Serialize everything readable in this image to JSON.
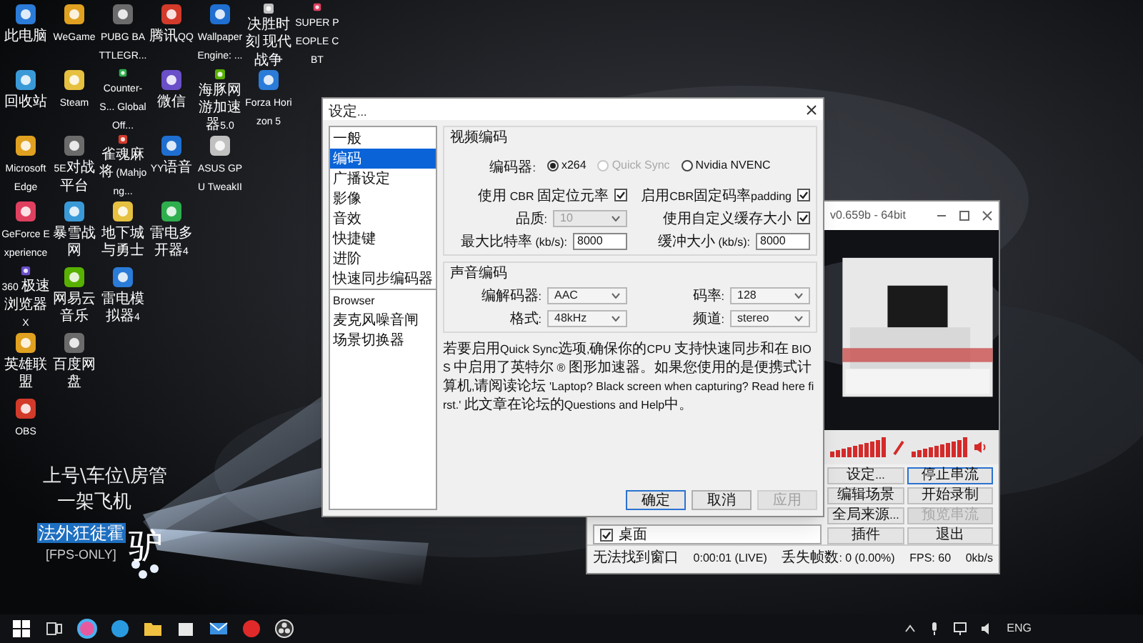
{
  "desktop": {
    "icon_rows": [
      [
        {
          "label": "此电脑"
        },
        {
          "label": "WeGame"
        },
        {
          "label": "PUBG BATTLEGR..."
        },
        {
          "label": "腾讯QQ"
        },
        {
          "label": "Wallpaper Engine: ..."
        },
        {
          "label": "决胜时刻 现代战争"
        },
        {
          "label": "SUPER PEOPLE CBT"
        }
      ],
      [
        {
          "label": "回收站"
        },
        {
          "label": "Steam"
        },
        {
          "label": "Counter-S... Global Off..."
        },
        {
          "label": "微信"
        },
        {
          "label": "海豚网游加速器5.0"
        },
        {
          "label": "Forza Horizon 5"
        }
      ],
      [
        {
          "label": "Microsoft Edge"
        },
        {
          "label": "5E对战平台"
        },
        {
          "label": "雀魂麻将 (Mahjong..."
        },
        {
          "label": "YY语音"
        },
        {
          "label": "ASUS GPU TweakII"
        }
      ],
      [
        {
          "label": "GeForce Experience"
        },
        {
          "label": "暴雪战网"
        },
        {
          "label": "地下城与勇士"
        },
        {
          "label": "雷电多开器4"
        }
      ],
      [
        {
          "label": "360 极速浏览器X"
        },
        {
          "label": "网易云音乐"
        },
        {
          "label": "雷电模拟器4"
        }
      ],
      [
        {
          "label": "英雄联盟"
        },
        {
          "label": "百度网盘"
        }
      ],
      [
        {
          "label": "OBS"
        }
      ]
    ]
  },
  "wallpaper_text": {
    "line_1": "上号\\车位\\房管",
    "line_2": "一架飞机",
    "name_tag": "法外狂徒霍",
    "tag": "[FPS-ONLY]",
    "logo_char": "驴"
  },
  "obs_window": {
    "title": "v0.659b - 64bit",
    "buttons": [
      {
        "label": "设定...",
        "disabled": false,
        "focused": false
      },
      {
        "label": "停止串流",
        "disabled": false,
        "focused": true
      },
      {
        "label": "编辑场景",
        "disabled": false,
        "focused": false
      },
      {
        "label": "开始录制",
        "disabled": false,
        "focused": false
      },
      {
        "label": "全局来源...",
        "disabled": false,
        "focused": false
      },
      {
        "label": "预览串流",
        "disabled": true,
        "focused": false
      },
      {
        "label": "插件",
        "disabled": false,
        "focused": false
      },
      {
        "label": "退出",
        "disabled": false,
        "focused": false
      }
    ],
    "sources": [
      {
        "label": "桌面",
        "checked": true
      }
    ],
    "status_bar": [
      "无法找到窗口",
      "0:00:01 (LIVE)",
      "丢失帧数: 0 (0.00%)",
      "FPS: 60",
      "0kb/s"
    ]
  },
  "settings_dialog": {
    "title": "设定...",
    "sidebar": [
      {
        "label": "一般",
        "selected": false
      },
      {
        "label": "编码",
        "selected": true
      },
      {
        "label": "广播设定",
        "selected": false
      },
      {
        "label": "影像",
        "selected": false
      },
      {
        "label": "音效",
        "selected": false
      },
      {
        "label": "快捷键",
        "selected": false
      },
      {
        "label": "进阶",
        "selected": false
      },
      {
        "label": "快速同步编码器",
        "selected": false
      },
      {
        "label": "Browser",
        "selected": false
      },
      {
        "label": "麦克风噪音闸",
        "selected": false
      },
      {
        "label": "场景切换器",
        "selected": false
      }
    ],
    "video_encoding": {
      "title": "视频编码",
      "encoder_label": "编码器:",
      "encoders": [
        {
          "label": "x264",
          "selected": true,
          "disabled": false
        },
        {
          "label": "Quick Sync",
          "selected": false,
          "disabled": true
        },
        {
          "label": "Nvidia NVENC",
          "selected": false,
          "disabled": false
        }
      ],
      "cbr": {
        "label": "使用 CBR 固定位元率",
        "checked": true
      },
      "cbr_padding": {
        "label": "启用CBR固定码率padding",
        "checked": true
      },
      "quality": {
        "label": "品质:",
        "value": "10",
        "disabled": true
      },
      "custom_buffer": {
        "label": "使用自定义缓存大小",
        "checked": true
      },
      "max_bitrate": {
        "label": "最大比特率 (kb/s):",
        "value": "8000"
      },
      "buffer_size": {
        "label": "缓冲大小 (kb/s):",
        "value": "8000"
      }
    },
    "audio_encoding": {
      "title": "声音编码",
      "fields": [
        {
          "label": "编解码器:",
          "value": "AAC"
        },
        {
          "label": "码率:",
          "value": "128"
        },
        {
          "label": "格式:",
          "value": "48kHz"
        },
        {
          "label": "频道:",
          "value": "stereo"
        }
      ]
    },
    "note": "若要启用Quick Sync选项,确保你的CPU 支持快速同步和在 BIOS 中启用了英特尔 ® 图形加速器。如果您使用的是便携式计算机,请阅读论坛 'Laptop? Black screen when capturing? Read here first.' 此文章在论坛的Questions and Help中。",
    "buttons": [
      {
        "label": "确定",
        "disabled": false
      },
      {
        "label": "取消",
        "disabled": false
      },
      {
        "label": "应用",
        "disabled": true
      }
    ]
  },
  "taskbar": {
    "language": "ENG"
  }
}
